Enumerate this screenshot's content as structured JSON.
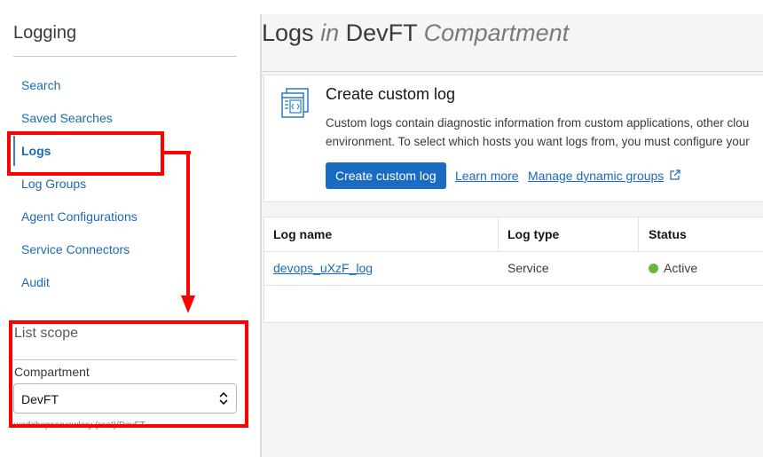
{
  "sidebar": {
    "title": "Logging",
    "items": [
      {
        "label": "Search"
      },
      {
        "label": "Saved Searches"
      },
      {
        "label": "Logs"
      },
      {
        "label": "Log Groups"
      },
      {
        "label": "Agent Configurations"
      },
      {
        "label": "Service Connectors"
      },
      {
        "label": "Audit"
      }
    ],
    "active_item": "Logs",
    "list_scope": {
      "title": "List scope",
      "compartment_label": "Compartment",
      "compartment_value": "DevFT",
      "compartment_path": "wedohopsorvowlory (root)/DevFT"
    }
  },
  "header": {
    "title_prefix": "Logs",
    "title_in": "in",
    "compartment": "DevFT",
    "title_suffix": "Compartment"
  },
  "custom_log_card": {
    "icon": "custom-log-icon",
    "title": "Create custom log",
    "description_line1": "Custom logs contain diagnostic information from custom applications, other clou",
    "description_line2": "environment. To select which hosts you want logs from, you must configure your",
    "create_button": "Create custom log",
    "learn_more": "Learn more",
    "manage_groups": "Manage dynamic groups"
  },
  "logs_table": {
    "columns": [
      "Log name",
      "Log type",
      "Status"
    ],
    "rows": [
      {
        "log_name": "devops_uXzF_log",
        "log_type": "Service",
        "status": "Active"
      }
    ]
  },
  "colors": {
    "accent": "#1a6bc4",
    "link": "#1a6bb4",
    "status_active": "#6ab43f",
    "annotation": "#ff0000"
  }
}
